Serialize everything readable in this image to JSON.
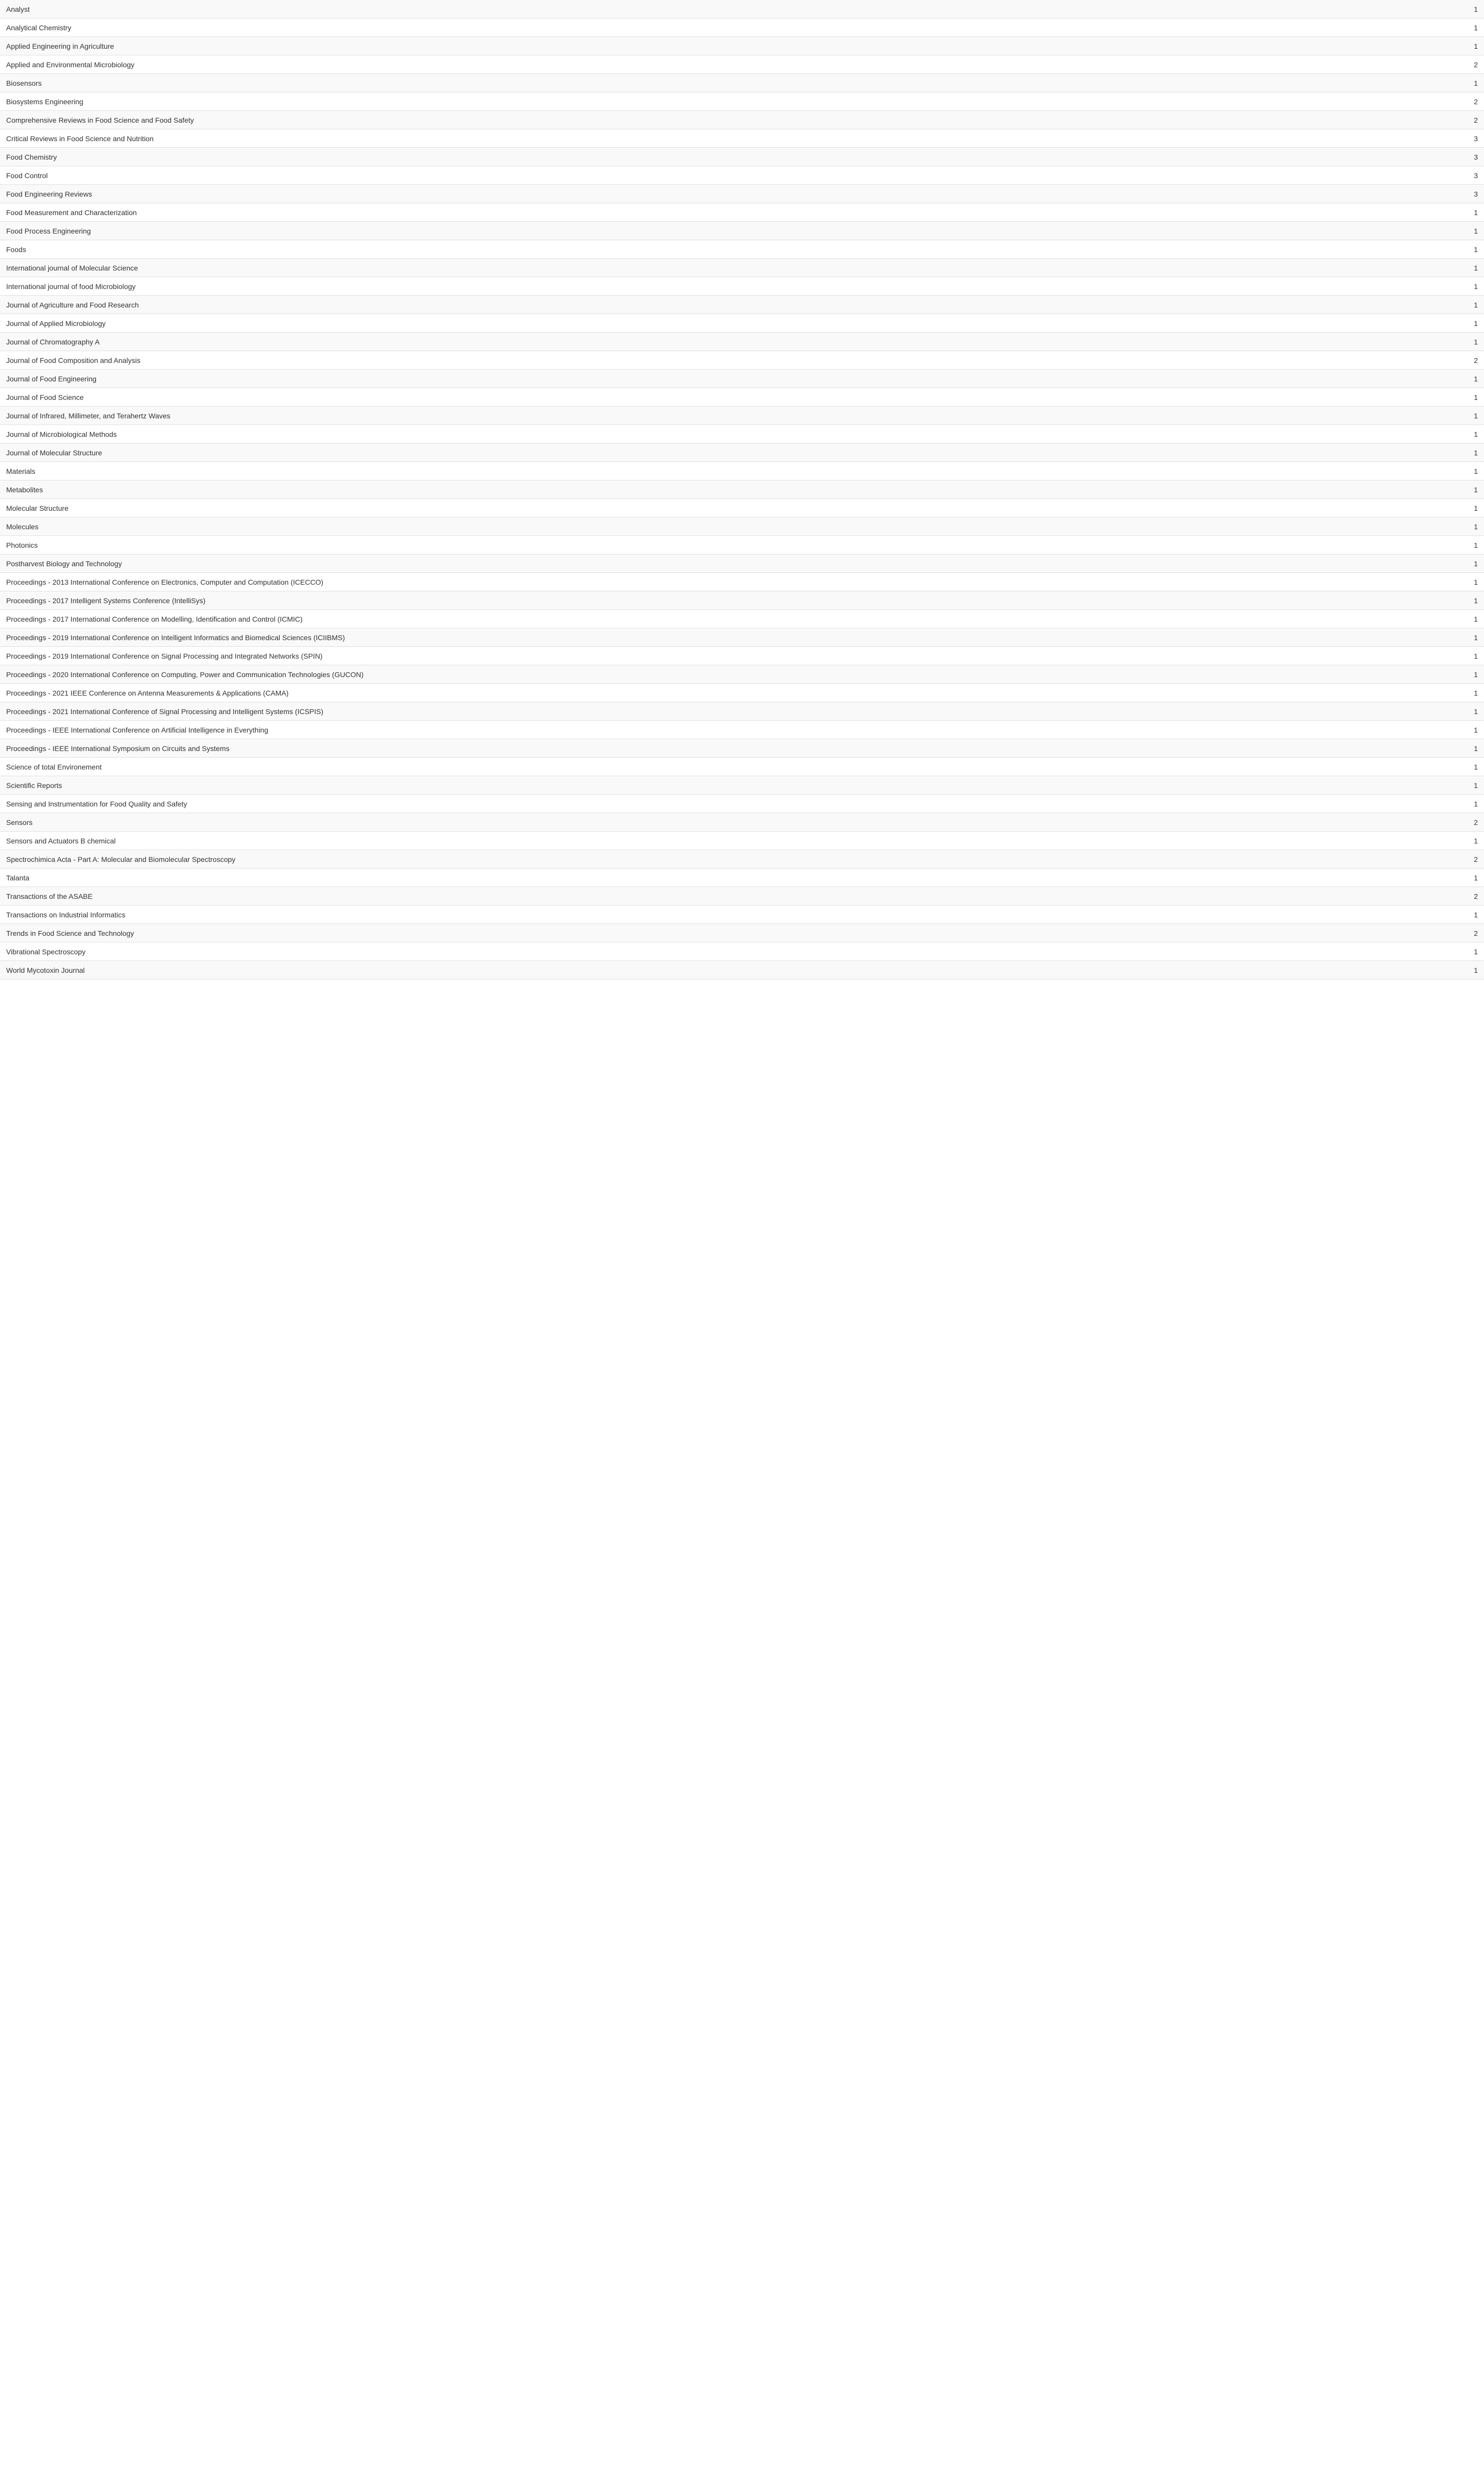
{
  "rows": [
    {
      "label": "Analyst",
      "value": "1"
    },
    {
      "label": "Analytical Chemistry",
      "value": "1"
    },
    {
      "label": "Applied Engineering in Agriculture",
      "value": "1"
    },
    {
      "label": "Applied and Environmental Microbiology",
      "value": "2"
    },
    {
      "label": "Biosensors",
      "value": "1"
    },
    {
      "label": "Biosystems Engineering",
      "value": "2"
    },
    {
      "label": "Comprehensive Reviews in Food Science and Food Safety",
      "value": "2"
    },
    {
      "label": "Critical Reviews in Food Science and Nutrition",
      "value": "3"
    },
    {
      "label": "Food Chemistry",
      "value": "3"
    },
    {
      "label": "Food Control",
      "value": "3"
    },
    {
      "label": "Food Engineering Reviews",
      "value": "3"
    },
    {
      "label": "Food Measurement and Characterization",
      "value": "1"
    },
    {
      "label": "Food Process Engineering",
      "value": "1"
    },
    {
      "label": "Foods",
      "value": "1"
    },
    {
      "label": "International journal of Molecular Science",
      "value": "1"
    },
    {
      "label": "International journal of food Microbiology",
      "value": "1"
    },
    {
      "label": "Journal of Agriculture and Food Research",
      "value": "1"
    },
    {
      "label": "Journal of Applied Microbiology",
      "value": "1"
    },
    {
      "label": "Journal of Chromatography A",
      "value": "1"
    },
    {
      "label": "Journal of Food Composition and Analysis",
      "value": "2"
    },
    {
      "label": "Journal of Food Engineering",
      "value": "1"
    },
    {
      "label": "Journal of Food Science",
      "value": "1"
    },
    {
      "label": "Journal of Infrared, Millimeter, and Terahertz Waves",
      "value": "1"
    },
    {
      "label": "Journal of Microbiological Methods",
      "value": "1"
    },
    {
      "label": "Journal of Molecular Structure",
      "value": "1"
    },
    {
      "label": "Materials",
      "value": "1"
    },
    {
      "label": "Metabolites",
      "value": "1"
    },
    {
      "label": "Molecular Structure",
      "value": "1"
    },
    {
      "label": "Molecules",
      "value": "1"
    },
    {
      "label": "Photonics",
      "value": "1"
    },
    {
      "label": "Postharvest Biology and Technology",
      "value": "1"
    },
    {
      "label": "Proceedings - 2013 International Conference on Electronics, Computer and Computation (ICECCO)",
      "value": "1"
    },
    {
      "label": "Proceedings - 2017 Intelligent Systems Conference (IntelliSys)",
      "value": "1"
    },
    {
      "label": "Proceedings - 2017 International Conference on Modelling, Identification and Control (ICMIC)",
      "value": "1"
    },
    {
      "label": "Proceedings - 2019 International Conference on Intelligent Informatics and Biomedical Sciences (ICIIBMS)",
      "value": "1"
    },
    {
      "label": "Proceedings - 2019 International Conference on Signal Processing and Integrated Networks (SPIN)",
      "value": "1"
    },
    {
      "label": "Proceedings - 2020 International Conference on Computing, Power and Communication Technologies (GUCON)",
      "value": "1"
    },
    {
      "label": "Proceedings - 2021 IEEE Conference on Antenna Measurements & Applications (CAMA)",
      "value": "1"
    },
    {
      "label": "Proceedings - 2021 International Conference of Signal Processing and Intelligent Systems (ICSPIS)",
      "value": "1"
    },
    {
      "label": "Proceedings - IEEE International Conference on Artificial Intelligence in Everything",
      "value": "1"
    },
    {
      "label": "Proceedings - IEEE International Symposium on Circuits and Systems",
      "value": "1"
    },
    {
      "label": "Science of total Environement",
      "value": "1"
    },
    {
      "label": "Scientific Reports",
      "value": "1"
    },
    {
      "label": "Sensing and Instrumentation for Food Quality and Safety",
      "value": "1"
    },
    {
      "label": "Sensors",
      "value": "2"
    },
    {
      "label": "Sensors and Actuators B chemical",
      "value": "1"
    },
    {
      "label": "Spectrochimica Acta - Part A: Molecular and Biomolecular Spectroscopy",
      "value": "2"
    },
    {
      "label": "Talanta",
      "value": "1"
    },
    {
      "label": "Transactions of the ASABE",
      "value": "2"
    },
    {
      "label": "Transactions on Industrial Informatics",
      "value": "1"
    },
    {
      "label": "Trends in Food Science and Technology",
      "value": "2"
    },
    {
      "label": "Vibrational Spectroscopy",
      "value": "1"
    },
    {
      "label": "World Mycotoxin Journal",
      "value": "1"
    }
  ]
}
